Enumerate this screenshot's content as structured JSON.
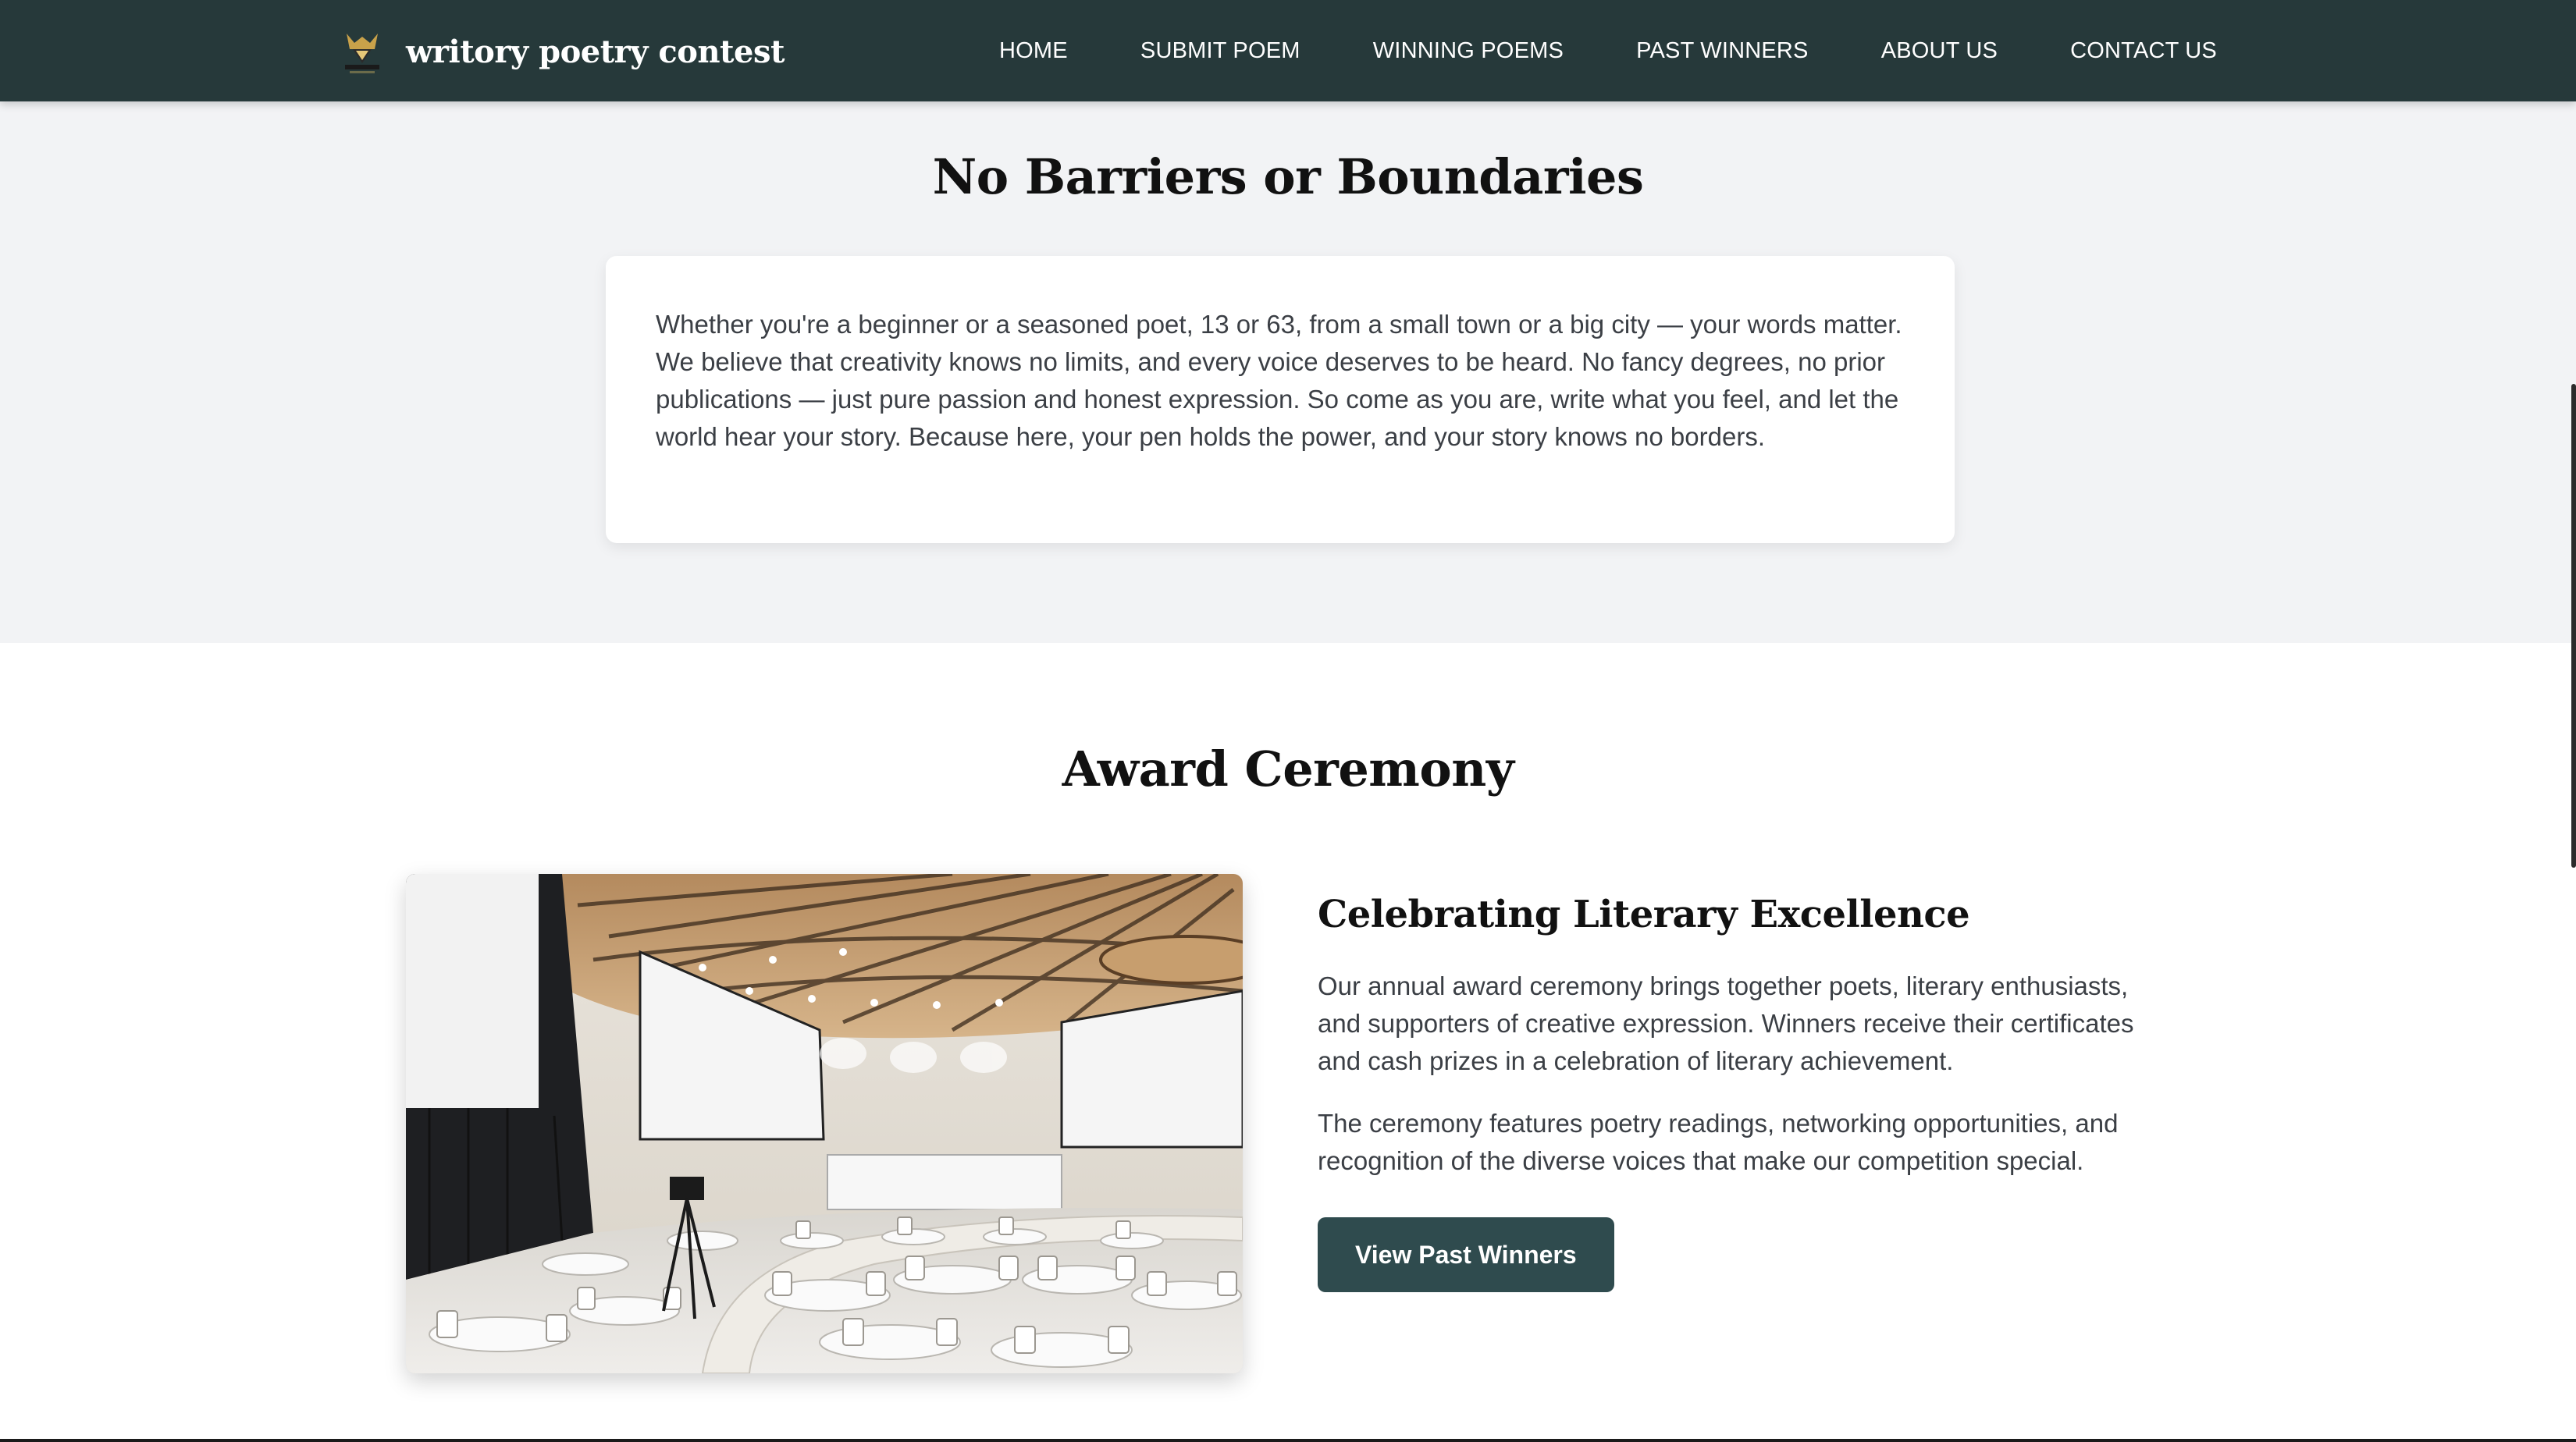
{
  "header": {
    "brand_name": "writory poetry contest",
    "logo_icon": "writory-logo-icon",
    "nav": [
      {
        "label": "HOME"
      },
      {
        "label": "SUBMIT POEM"
      },
      {
        "label": "WINNING POEMS"
      },
      {
        "label": "PAST WINNERS"
      },
      {
        "label": "ABOUT US"
      },
      {
        "label": "CONTACT US"
      }
    ],
    "background_color": "#26393a"
  },
  "barriers_section": {
    "title": "No Barriers or Boundaries",
    "body": "Whether you're a beginner or a seasoned poet, 13 or 63, from a small town or a big city — your words matter. We believe that creativity knows no limits, and every voice deserves to be heard. No fancy degrees, no prior publications — just pure passion and honest expression. So come as you are, write what you feel, and let the world hear your story. Because here, your pen holds the power, and your story knows no borders.",
    "background_color": "#f2f3f5"
  },
  "ceremony_section": {
    "title": "Award Ceremony",
    "image_icon": "conference-hall-photo",
    "subtitle": "Celebrating Literary Excellence",
    "paragraph_1": "Our annual award ceremony brings together poets, literary enthusiasts, and supporters of creative expression. Winners receive their certificates and cash prizes in a celebration of literary achievement.",
    "paragraph_2": "The ceremony features poetry readings, networking opportunities, and recognition of the diverse voices that make our competition special.",
    "button_label": "View Past Winners",
    "button_color": "#2f4b4e"
  }
}
